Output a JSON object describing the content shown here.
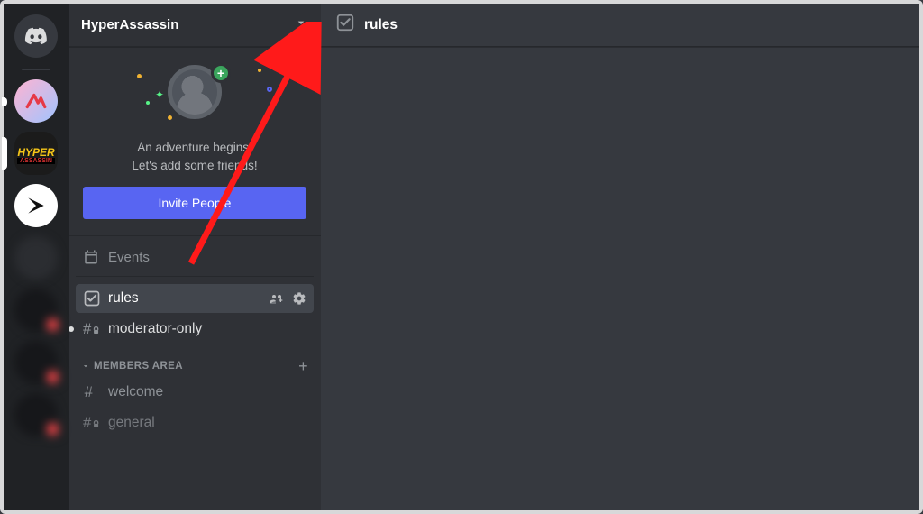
{
  "server": {
    "name": "HyperAssassin"
  },
  "invite_card": {
    "line1": "An adventure begins.",
    "line2": "Let's add some friends!",
    "button": "Invite People"
  },
  "events_label": "Events",
  "channels": {
    "rules": "rules",
    "moderator_only": "moderator-only",
    "welcome": "welcome",
    "general": "general"
  },
  "category": {
    "members_area": "MEMBERS AREA"
  },
  "main": {
    "channel_title": "rules"
  },
  "server_rail": {
    "hyper_label_top": "HYPER",
    "hyper_label_bottom": "ASSASSIN"
  },
  "colors": {
    "blurple": "#5865f2",
    "green": "#3ba55d",
    "sidebar": "#2f3136",
    "rail": "#202225",
    "main": "#36393f"
  }
}
